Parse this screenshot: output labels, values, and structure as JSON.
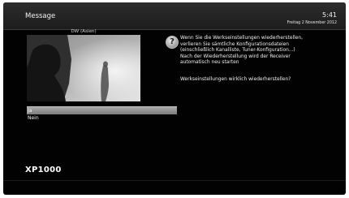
{
  "header": {
    "title": "Message",
    "time": "5:41",
    "date": "Freitag  2 November 2012"
  },
  "preview": {
    "channel": "DW (Asien)"
  },
  "dialog": {
    "icon": "question-icon",
    "message": "Wenn Sie die Werkseinstellungen wiederherstellen,\nverlieren Sie sämtliche Konfigurationsdateien\n(einschließlich Kanalliste, Tuner-Konfiguration...)\nNach der Wiederherstellung wird der Receiver\nautomatisch neu starten",
    "question": "Werkseinstellungen wirklich wiederherstellen?",
    "choices": [
      {
        "label": "Ja",
        "selected": true
      },
      {
        "label": "Nein",
        "selected": false
      }
    ]
  },
  "footer": {
    "model": "XP1000"
  }
}
